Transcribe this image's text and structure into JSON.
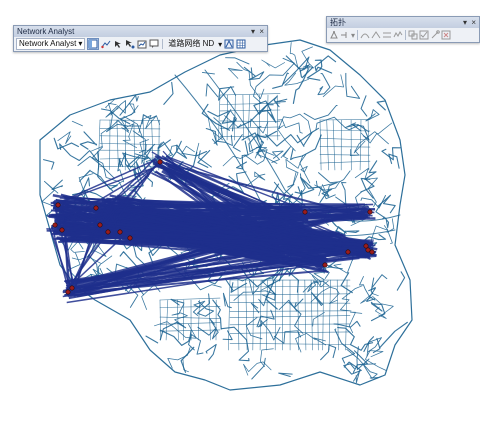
{
  "network_analyst_toolbar": {
    "title": "Network Analyst",
    "dropdown_label": "Network Analyst",
    "dropdown_arrow": "▾",
    "network_dataset_label": "道路网络 ND",
    "close_glyph": "×",
    "pin_glyph": "▾",
    "tools": [
      "network-analyst-window-icon",
      "new-route-icon",
      "create-network-location-icon",
      "select-network-location-icon",
      "solve-icon",
      "directions-icon"
    ]
  },
  "topology_toolbar": {
    "title": "拓扑",
    "close_glyph": "×",
    "pin_glyph": "▾",
    "dropdown_arrow": "▾",
    "tools": [
      "topology-edit-icon",
      "map-topology-icon",
      "reshape-edge-icon",
      "modify-edge-icon",
      "align-edge-icon",
      "generalize-edge-icon",
      "show-shared-features-icon",
      "validate-topology-icon",
      "fix-topology-error-icon",
      "error-inspector-icon"
    ]
  },
  "map": {
    "road_color": "#165f8f",
    "od_line_color": "#1f2f8c",
    "point_color": "#9b1c1c",
    "description_visible": false
  }
}
